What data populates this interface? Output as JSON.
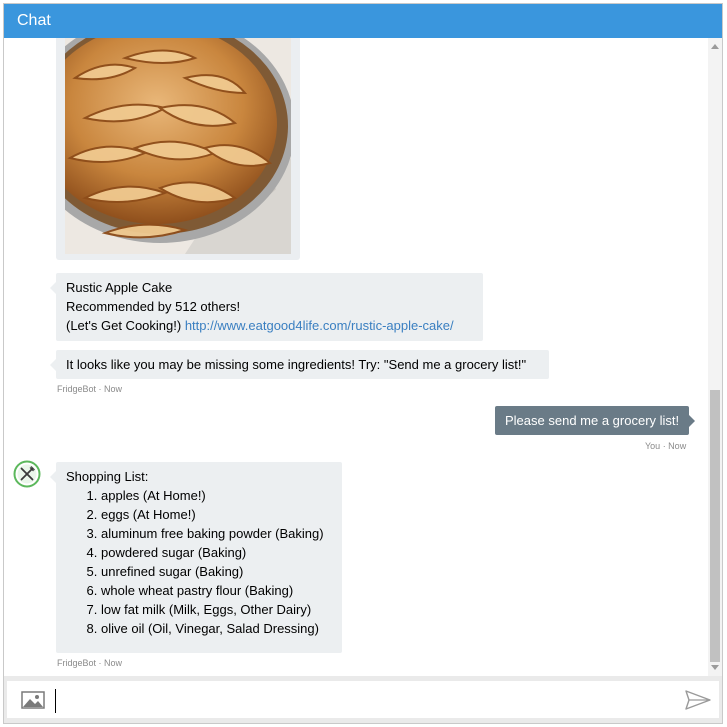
{
  "window": {
    "title": "Chat"
  },
  "history": {
    "recipe_card": {
      "name": "Rustic Apple Cake",
      "recommendation": "Recommended by 512 others!",
      "link_prefix": "(Let's Get Cooking!) ",
      "link_url": "http://www.eatgood4life.com/rustic-apple-cake/"
    },
    "hint_message": "It looks like you may be missing some ingredients! Try: \"Send me a grocery list!\"",
    "bot_meta_1": "FridgeBot · Now",
    "user_message": "Please send me a grocery list!",
    "user_meta": "You · Now",
    "shopping_list": {
      "heading": "Shopping List:",
      "items": [
        "apples (At Home!)",
        "eggs (At Home!)",
        "aluminum free baking powder (Baking)",
        "powdered sugar (Baking)",
        "unrefined sugar (Baking)",
        "whole wheat pastry flour (Baking)",
        "low fat milk (Milk, Eggs, Other Dairy)",
        "olive oil (Oil, Vinegar, Salad Dressing)"
      ]
    },
    "bot_meta_2": "FridgeBot · Now"
  },
  "composer": {
    "input_value": "",
    "placeholder": ""
  },
  "icons": {
    "image_upload": "image-icon",
    "send": "send-icon",
    "bot_avatar": "fork-knife-icon"
  },
  "colors": {
    "titlebar": "#3a96dd",
    "bot_bubble": "#eceff1",
    "user_bubble": "#6a7b87",
    "link": "#3a7fc1",
    "avatar_green": "#5cb85c"
  }
}
